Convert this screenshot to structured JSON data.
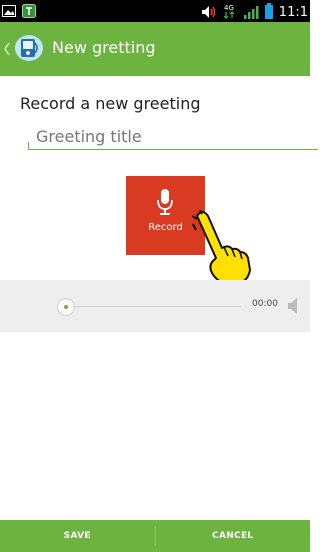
{
  "status_bar": {
    "time": "11:1",
    "network_type": "4G",
    "icons": [
      "picture-icon",
      "notification-app-icon",
      "volume-icon",
      "network-type-icon",
      "signal-icon",
      "battery-icon"
    ]
  },
  "app_bar": {
    "title": "New gretting",
    "icons": [
      "back-chevron-icon",
      "greeting-app-icon"
    ]
  },
  "form": {
    "heading": "Record a new greeting",
    "title_placeholder": "Greeting title",
    "title_value": ""
  },
  "record": {
    "label": "Record",
    "icon": "microphone-icon"
  },
  "player": {
    "duration": "00:00",
    "progress": 0,
    "icons": [
      "play-position-icon",
      "speaker-icon"
    ]
  },
  "footer": {
    "save_label": "SAVE",
    "cancel_label": "CANCEL"
  },
  "colors": {
    "accent": "#6db33f",
    "record": "#d83a22",
    "status_bar": "#000000",
    "player_bg": "#eeeeee"
  }
}
